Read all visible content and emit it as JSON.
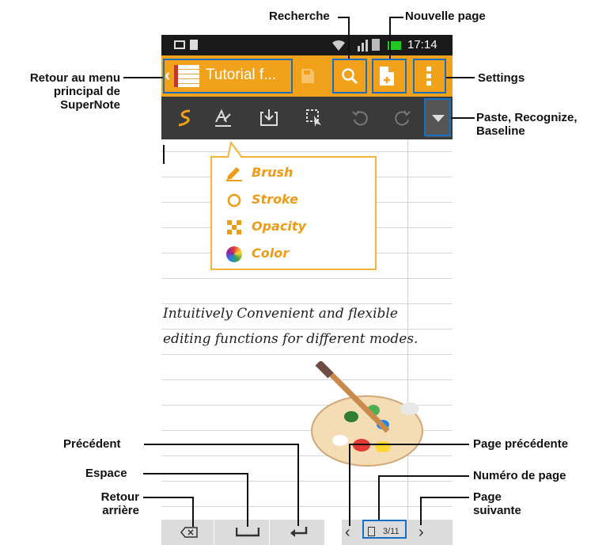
{
  "status_bar": {
    "time": "17:14"
  },
  "action_bar": {
    "title": "Tutorial f..."
  },
  "bubble": {
    "items": [
      {
        "label": "Brush",
        "icon": "pen-icon"
      },
      {
        "label": "Stroke",
        "icon": "circle-icon"
      },
      {
        "label": "Opacity",
        "icon": "opacity-icon"
      },
      {
        "label": "Color",
        "icon": "color-wheel-icon"
      }
    ]
  },
  "handwriting": {
    "line1": "Intuitively Convenient and flexible",
    "line2": "editing functions for different modes."
  },
  "bottom_bar": {
    "page_number": "3/11"
  },
  "annotations": {
    "recherche": "Recherche",
    "nouvelle_page": "Nouvelle page",
    "settings": "Settings",
    "retour_menu": "Retour au menu principal de SuperNote",
    "paste": "Paste, Recognize, Baseline",
    "precedent": "Précédent",
    "espace": "Espace",
    "retour_arriere": "Retour arrière",
    "page_precedente": "Page précédente",
    "numero_page": "Numéro de page",
    "page_suivante": "Page suivante"
  },
  "colors": {
    "accent": "#f2a21a",
    "toolbar": "#3a3a3a",
    "highlight": "#1a6fc2",
    "paper_margin": "#f0c8b8"
  }
}
